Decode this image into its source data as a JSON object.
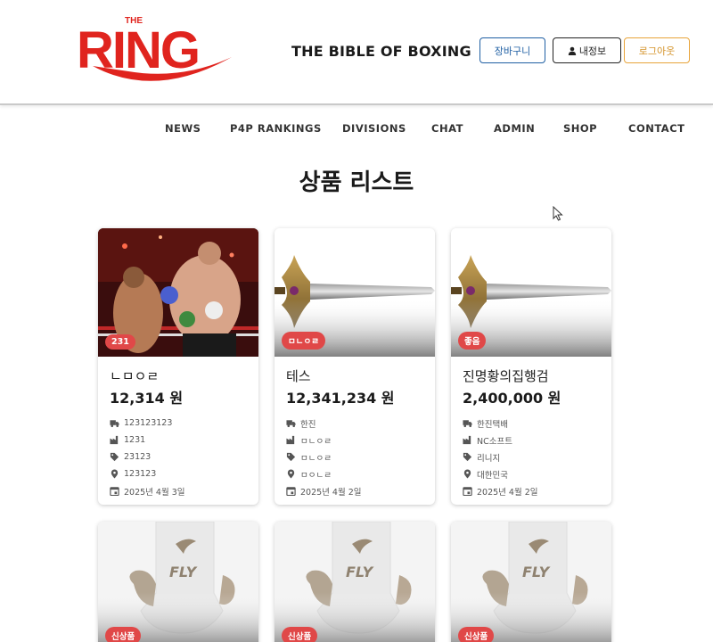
{
  "header": {
    "logo_small": "THE",
    "logo_big": "RING",
    "tagline": "THE BIBLE OF BOXING",
    "cart_label": "장바구니",
    "myinfo_label": "내정보",
    "logout_label": "로그아웃"
  },
  "nav": [
    "NEWS",
    "P4P RANKINGS",
    "DIVISIONS",
    "CHAT",
    "ADMIN",
    "SHOP",
    "CONTACT"
  ],
  "page_title": "상품 리스트",
  "products": [
    {
      "badge": "231",
      "name": "ㄴㅁㅇㄹ",
      "price": "12,314 원",
      "shipping": "123123123",
      "maker": "1231",
      "tag": "23123",
      "location": "123123",
      "date": "2025년 4월 3일",
      "image": "boxing-match-photo"
    },
    {
      "badge": "ㅁㄴㅇㄹ",
      "name": "테스",
      "price": "12,341,234 원",
      "shipping": "한진",
      "maker": "ㅁㄴㅇㄹ",
      "tag": "ㅁㄴㅇㄹ",
      "location": "ㅁㅇㄴㄹ",
      "date": "2025년 4월 2일",
      "image": "sword"
    },
    {
      "badge": "좋음",
      "name": "진명황의집행검",
      "price": "2,400,000 원",
      "shipping": "한진택배",
      "maker": "NC소프트",
      "tag": "리니지",
      "location": "대한민국",
      "date": "2025년 4월 2일",
      "image": "sword"
    },
    {
      "badge": "신상품",
      "image": "boxing-glove-fly"
    },
    {
      "badge": "신상품",
      "image": "boxing-glove-fly"
    },
    {
      "badge": "신상품",
      "image": "boxing-glove-fly"
    }
  ],
  "colors": {
    "brand_red": "#e0241e",
    "badge_red": "#e04848",
    "cart_blue": "#1f5fa3",
    "logout_orange": "#e8a43a"
  },
  "icons": {
    "shipping": "truck-icon",
    "maker": "factory-icon",
    "tag": "tag-icon",
    "location": "map-pin-icon",
    "date": "calendar-icon",
    "myinfo": "user-icon"
  }
}
